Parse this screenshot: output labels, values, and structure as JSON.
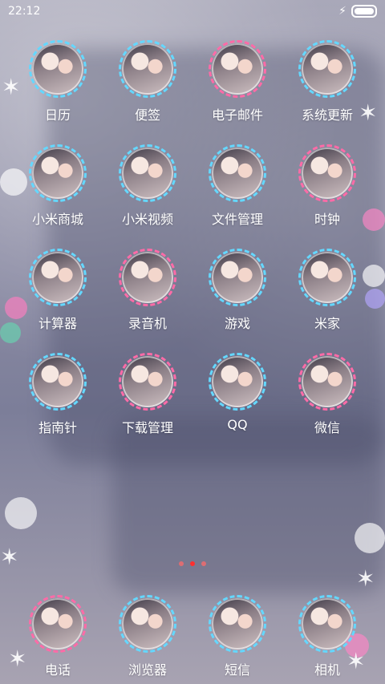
{
  "status": {
    "time": "22:12",
    "charging_icon": "bolt-icon",
    "battery_icon": "battery-icon"
  },
  "apps": [
    {
      "label": "日历",
      "ring": "#60d7ff"
    },
    {
      "label": "便签",
      "ring": "#60d7ff"
    },
    {
      "label": "电子邮件",
      "ring": "#ff6ba7"
    },
    {
      "label": "系统更新",
      "ring": "#60d7ff"
    },
    {
      "label": "小米商城",
      "ring": "#60d7ff"
    },
    {
      "label": "小米视频",
      "ring": "#60d7ff"
    },
    {
      "label": "文件管理",
      "ring": "#60d7ff"
    },
    {
      "label": "时钟",
      "ring": "#ff6ba7"
    },
    {
      "label": "计算器",
      "ring": "#60d7ff"
    },
    {
      "label": "录音机",
      "ring": "#ff6ba7"
    },
    {
      "label": "游戏",
      "ring": "#60d7ff"
    },
    {
      "label": "米家",
      "ring": "#60d7ff"
    },
    {
      "label": "指南针",
      "ring": "#60d7ff"
    },
    {
      "label": "下载管理",
      "ring": "#ff6ba7"
    },
    {
      "label": "QQ",
      "ring": "#60d7ff"
    },
    {
      "label": "微信",
      "ring": "#ff6ba7"
    }
  ],
  "page_indicator": {
    "count": 3,
    "active_index": 1
  },
  "dock": [
    {
      "label": "电话",
      "ring": "#ff6ba7"
    },
    {
      "label": "浏览器",
      "ring": "#60d7ff"
    },
    {
      "label": "短信",
      "ring": "#60d7ff"
    },
    {
      "label": "相机",
      "ring": "#60d7ff"
    }
  ]
}
